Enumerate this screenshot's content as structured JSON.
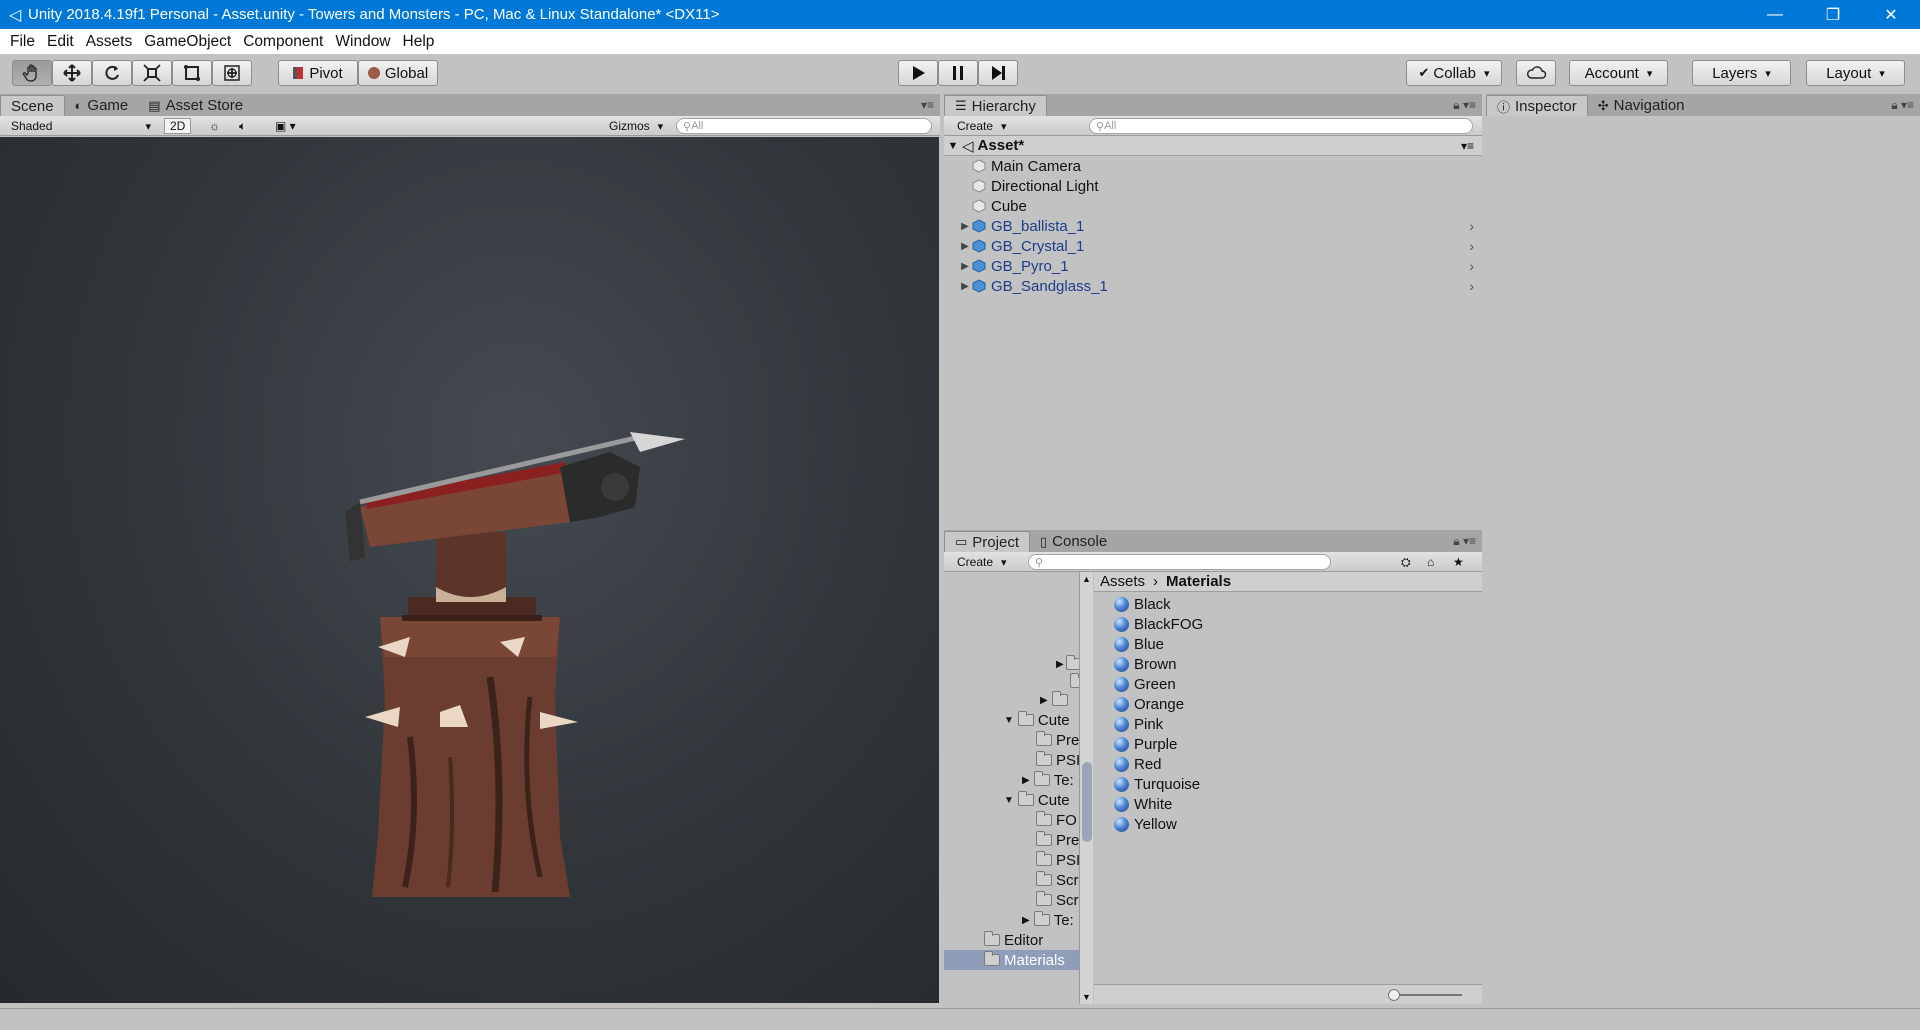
{
  "window": {
    "title": "Unity 2018.4.19f1 Personal - Asset.unity - Towers and Monsters - PC, Mac & Linux Standalone* <DX11>",
    "controls": [
      "—",
      "❐",
      "✕"
    ]
  },
  "menu": [
    "File",
    "Edit",
    "Assets",
    "GameObject",
    "Component",
    "Window",
    "Help"
  ],
  "toolbar": {
    "pivot_label": "Pivot",
    "global_label": "Global",
    "collab_label": "Collab",
    "account_label": "Account",
    "layers_label": "Layers",
    "layout_label": "Layout"
  },
  "scene_panel": {
    "tabs": [
      "Scene",
      "Game",
      "Asset Store"
    ],
    "shading": "Shaded",
    "mode_2d": "2D",
    "gizmos": "Gizmos",
    "search_placeholder": "All"
  },
  "hierarchy": {
    "tab": "Hierarchy",
    "create": "Create",
    "search_placeholder": "All",
    "root": "Asset*",
    "items": [
      {
        "label": "Main Camera"
      },
      {
        "label": "Directional Light"
      },
      {
        "label": "Cube"
      },
      {
        "label": "GB_ballista_1"
      },
      {
        "label": "GB_Crystal_1"
      },
      {
        "label": "GB_Pyro_1"
      },
      {
        "label": "GB_Sandglass_1"
      }
    ]
  },
  "inspector": {
    "tabs": [
      "Inspector",
      "Navigation"
    ]
  },
  "project": {
    "tabs": [
      "Project",
      "Console"
    ],
    "create": "Create",
    "tree": [
      {
        "label": "Cute"
      },
      {
        "label": "Pre"
      },
      {
        "label": "PSI"
      },
      {
        "label": "Te:"
      },
      {
        "label": "Cute"
      },
      {
        "label": "FO"
      },
      {
        "label": "Pre"
      },
      {
        "label": "PSI"
      },
      {
        "label": "Scr"
      },
      {
        "label": "Scr"
      },
      {
        "label": "Te:"
      },
      {
        "label": "Editor"
      },
      {
        "label": "Materials"
      }
    ],
    "breadcrumb": [
      "Assets",
      "Materials"
    ],
    "materials": [
      "Black",
      "BlackFOG",
      "Blue",
      "Brown",
      "Green",
      "Orange",
      "Pink",
      "Purple",
      "Red",
      "Turquoise",
      "White",
      "Yellow"
    ]
  }
}
